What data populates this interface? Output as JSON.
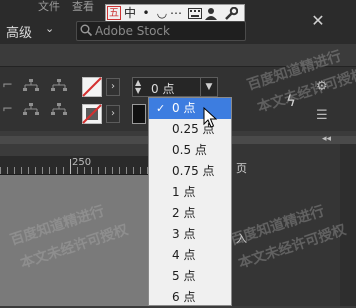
{
  "menubar": {
    "items": [
      "文件",
      "查看"
    ]
  },
  "ime": {
    "mode": "五",
    "chinese": "中",
    "punctuation": "•",
    "half_full": "◡",
    "soft_kbd": "⋯"
  },
  "workspace": {
    "label": "高级",
    "chevron": "⌄"
  },
  "search": {
    "placeholder": "Adobe Stock"
  },
  "window": {
    "close": "✕"
  },
  "stroke": {
    "value": "0 点"
  },
  "dropdown": {
    "check": "✓",
    "items": [
      {
        "label": "0 点"
      },
      {
        "label": "0.25 点"
      },
      {
        "label": "0.5 点"
      },
      {
        "label": "0.75 点"
      },
      {
        "label": "1 点"
      },
      {
        "label": "2 点"
      },
      {
        "label": "3 点"
      },
      {
        "label": "4 点"
      },
      {
        "label": "5 点"
      },
      {
        "label": "6 点"
      }
    ]
  },
  "ruler": {
    "number": "250"
  },
  "right_panel": {
    "vertical_chars": [
      "页",
      "入"
    ]
  },
  "watermark": {
    "text_a": "百度知道精进行",
    "text_b": "本文未经许可授权"
  },
  "colors": {
    "selection": "#3d7de0",
    "dropdown_bg": "#f0f0f0",
    "panel_bg": "#323232",
    "topbar_bg": "#2b2b2b"
  }
}
